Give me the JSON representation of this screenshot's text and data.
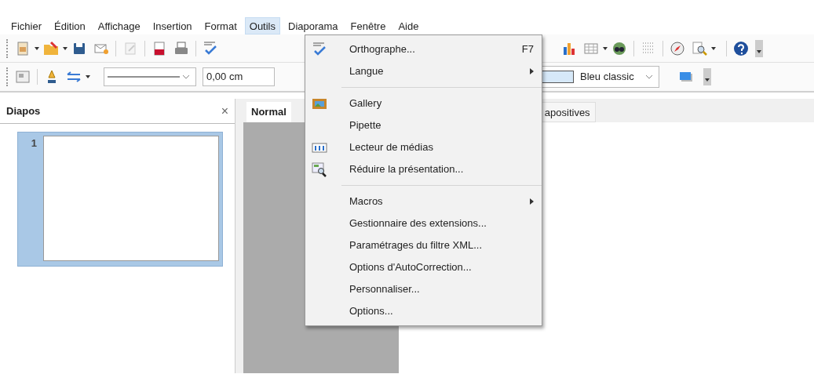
{
  "menubar": [
    {
      "label": "Fichier",
      "selected": false
    },
    {
      "label": "Édition",
      "selected": false
    },
    {
      "label": "Affichage",
      "selected": false
    },
    {
      "label": "Insertion",
      "selected": false
    },
    {
      "label": "Format",
      "selected": false
    },
    {
      "label": "Outils",
      "selected": true
    },
    {
      "label": "Diaporama",
      "selected": false
    },
    {
      "label": "Fenêtre",
      "selected": false
    },
    {
      "label": "Aide",
      "selected": false
    }
  ],
  "line_width": {
    "value": "0,00 cm"
  },
  "fill_color": {
    "value": "Bleu classic"
  },
  "slides_panel": {
    "title": "Diapos",
    "close": "×",
    "slides": [
      {
        "number": "1",
        "selected": true
      }
    ]
  },
  "view_tabs": [
    {
      "label": "Normal",
      "selected": true
    },
    {
      "label": "apositives",
      "selected": false
    }
  ],
  "menu": {
    "groups": [
      [
        {
          "label": "Orthographe...",
          "shortcut": "F7",
          "submenu": false
        },
        {
          "label": "Langue",
          "submenu": true
        }
      ],
      [
        {
          "label": "Gallery",
          "submenu": false
        },
        {
          "label": "Pipette",
          "submenu": false
        },
        {
          "label": "Lecteur de médias",
          "submenu": false
        },
        {
          "label": "Réduire la présentation...",
          "submenu": false
        }
      ],
      [
        {
          "label": "Macros",
          "submenu": true
        },
        {
          "label": "Gestionnaire des extensions...",
          "submenu": false
        },
        {
          "label": "Paramétrages du filtre XML...",
          "submenu": false
        },
        {
          "label": "Options d'AutoCorrection...",
          "submenu": false
        },
        {
          "label": "Personnaliser...",
          "submenu": false
        },
        {
          "label": "Options...",
          "submenu": false
        }
      ]
    ]
  }
}
